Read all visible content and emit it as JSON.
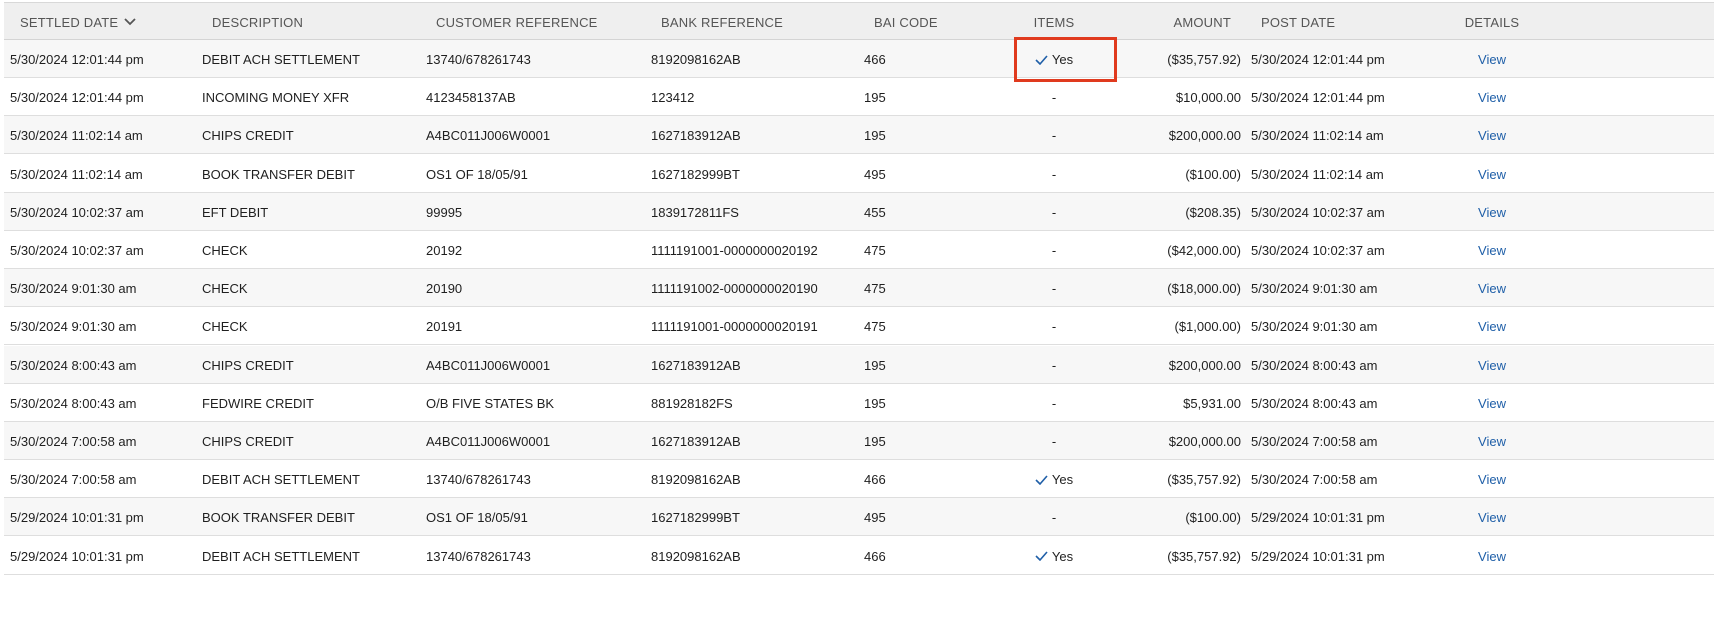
{
  "headers": {
    "settled_date": "SETTLED DATE",
    "description": "DESCRIPTION",
    "customer_reference": "CUSTOMER REFERENCE",
    "bank_reference": "BANK REFERENCE",
    "bai_code": "BAI CODE",
    "items": "ITEMS",
    "amount": "AMOUNT",
    "post_date": "POST DATE",
    "details": "DETAILS"
  },
  "sort": {
    "column": "settled_date",
    "direction": "descending",
    "icon": "chevron-down-icon"
  },
  "items_yes_icon": "checkmark-icon",
  "highlight_color": "#e03a1e",
  "link_color": "#1f5fa8",
  "rows": [
    {
      "settled_date": "5/30/2024 12:01:44 pm",
      "description": "DEBIT ACH SETTLEMENT",
      "customer_reference": "13740/678261743",
      "bank_reference": "8192098162AB",
      "bai_code": "466",
      "items": "Yes",
      "amount": "($35,757.92)",
      "post_date": "5/30/2024 12:01:44 pm",
      "details": "View"
    },
    {
      "settled_date": "5/30/2024 12:01:44 pm",
      "description": "INCOMING MONEY XFR",
      "customer_reference": "4123458137AB",
      "bank_reference": "123412",
      "bai_code": "195",
      "items": "-",
      "amount": "$10,000.00",
      "post_date": "5/30/2024 12:01:44 pm",
      "details": "View"
    },
    {
      "settled_date": "5/30/2024 11:02:14 am",
      "description": "CHIPS CREDIT",
      "customer_reference": "A4BC011J006W0001",
      "bank_reference": "1627183912AB",
      "bai_code": "195",
      "items": "-",
      "amount": "$200,000.00",
      "post_date": "5/30/2024 11:02:14 am",
      "details": "View"
    },
    {
      "settled_date": "5/30/2024 11:02:14 am",
      "description": "BOOK TRANSFER DEBIT",
      "customer_reference": "OS1 OF 18/05/91",
      "bank_reference": "1627182999BT",
      "bai_code": "495",
      "items": "-",
      "amount": "($100.00)",
      "post_date": "5/30/2024 11:02:14 am",
      "details": "View"
    },
    {
      "settled_date": "5/30/2024 10:02:37 am",
      "description": "EFT DEBIT",
      "customer_reference": "99995",
      "bank_reference": "1839172811FS",
      "bai_code": "455",
      "items": "-",
      "amount": "($208.35)",
      "post_date": "5/30/2024 10:02:37 am",
      "details": "View"
    },
    {
      "settled_date": "5/30/2024 10:02:37 am",
      "description": "CHECK",
      "customer_reference": "20192",
      "bank_reference": "1111191001-0000000020192",
      "bai_code": "475",
      "items": "-",
      "amount": "($42,000.00)",
      "post_date": "5/30/2024 10:02:37 am",
      "details": "View"
    },
    {
      "settled_date": "5/30/2024 9:01:30 am",
      "description": "CHECK",
      "customer_reference": "20190",
      "bank_reference": "1111191002-0000000020190",
      "bai_code": "475",
      "items": "-",
      "amount": "($18,000.00)",
      "post_date": "5/30/2024 9:01:30 am",
      "details": "View"
    },
    {
      "settled_date": "5/30/2024 9:01:30 am",
      "description": "CHECK",
      "customer_reference": "20191",
      "bank_reference": "1111191001-0000000020191",
      "bai_code": "475",
      "items": "-",
      "amount": "($1,000.00)",
      "post_date": "5/30/2024 9:01:30 am",
      "details": "View"
    },
    {
      "settled_date": "5/30/2024 8:00:43 am",
      "description": "CHIPS CREDIT",
      "customer_reference": "A4BC011J006W0001",
      "bank_reference": "1627183912AB",
      "bai_code": "195",
      "items": "-",
      "amount": "$200,000.00",
      "post_date": "5/30/2024 8:00:43 am",
      "details": "View"
    },
    {
      "settled_date": "5/30/2024 8:00:43 am",
      "description": "FEDWIRE CREDIT",
      "customer_reference": "O/B FIVE STATES BK",
      "bank_reference": "881928182FS",
      "bai_code": "195",
      "items": "-",
      "amount": "$5,931.00",
      "post_date": "5/30/2024 8:00:43 am",
      "details": "View"
    },
    {
      "settled_date": "5/30/2024 7:00:58 am",
      "description": "CHIPS CREDIT",
      "customer_reference": "A4BC011J006W0001",
      "bank_reference": "1627183912AB",
      "bai_code": "195",
      "items": "-",
      "amount": "$200,000.00",
      "post_date": "5/30/2024 7:00:58 am",
      "details": "View"
    },
    {
      "settled_date": "5/30/2024 7:00:58 am",
      "description": "DEBIT ACH SETTLEMENT",
      "customer_reference": "13740/678261743",
      "bank_reference": "8192098162AB",
      "bai_code": "466",
      "items": "Yes",
      "amount": "($35,757.92)",
      "post_date": "5/30/2024 7:00:58 am",
      "details": "View"
    },
    {
      "settled_date": "5/29/2024 10:01:31 pm",
      "description": "BOOK TRANSFER DEBIT",
      "customer_reference": "OS1 OF 18/05/91",
      "bank_reference": "1627182999BT",
      "bai_code": "495",
      "items": "-",
      "amount": "($100.00)",
      "post_date": "5/29/2024 10:01:31 pm",
      "details": "View"
    },
    {
      "settled_date": "5/29/2024 10:01:31 pm",
      "description": "DEBIT ACH SETTLEMENT",
      "customer_reference": "13740/678261743",
      "bank_reference": "8192098162AB",
      "bai_code": "466",
      "items": "Yes",
      "amount": "($35,757.92)",
      "post_date": "5/29/2024 10:01:31 pm",
      "details": "View"
    }
  ]
}
